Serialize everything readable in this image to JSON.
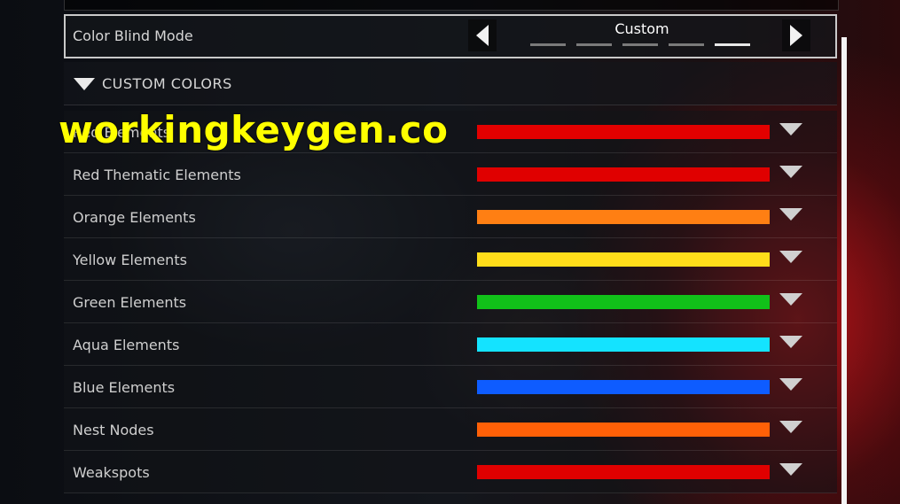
{
  "color_blind_mode": {
    "label": "Color Blind Mode",
    "value": "Custom",
    "options_count": 5,
    "selected_index": 4
  },
  "custom_colors": {
    "section_label": "CUSTOM COLORS",
    "rows": [
      {
        "label": "Red Elements",
        "color": "#e30000"
      },
      {
        "label": "Red Thematic Elements",
        "color": "#e00000"
      },
      {
        "label": "Orange Elements",
        "color": "#ff7f13"
      },
      {
        "label": "Yellow Elements",
        "color": "#ffdd1a"
      },
      {
        "label": "Green Elements",
        "color": "#11c119"
      },
      {
        "label": "Aqua Elements",
        "color": "#14e3ff"
      },
      {
        "label": "Blue Elements",
        "color": "#0e5cff"
      },
      {
        "label": "Nest Nodes",
        "color": "#ff6007"
      },
      {
        "label": "Weakspots",
        "color": "#e00000"
      }
    ]
  },
  "icons": {
    "arrow_left": "chevron-left-icon",
    "arrow_right": "chevron-right-icon",
    "expand": "triangle-down-icon"
  },
  "watermark": "workingkeygen.co"
}
